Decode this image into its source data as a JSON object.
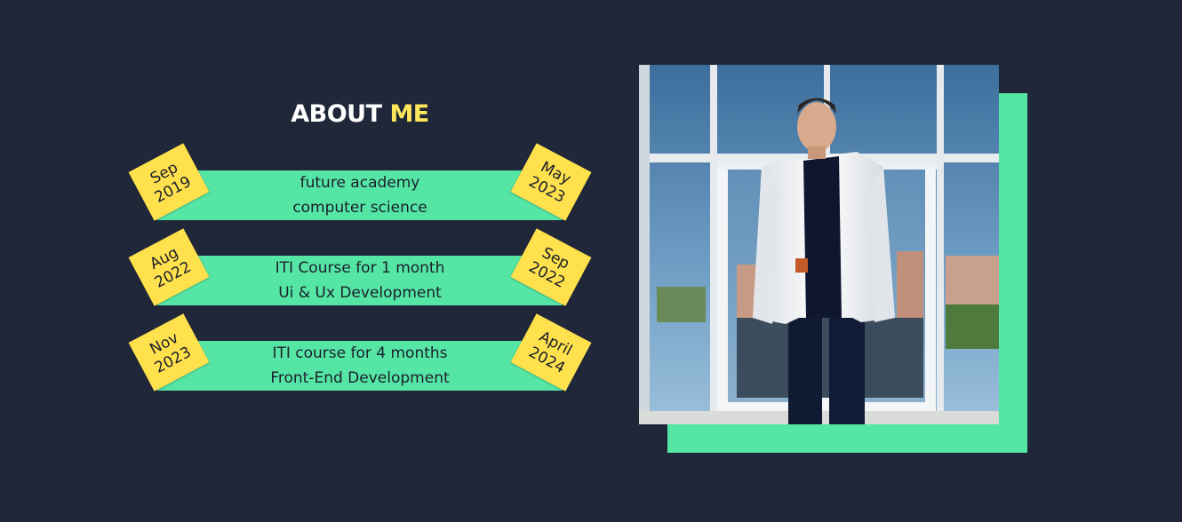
{
  "about": {
    "title_main": "ABOUT",
    "title_accent": "ME"
  },
  "timeline": [
    {
      "start_month": "Sep",
      "start_year": "2019",
      "line1": "future academy",
      "line2": "computer science",
      "end_month": "May",
      "end_year": "2023"
    },
    {
      "start_month": "Aug",
      "start_year": "2022",
      "line1": "ITI Course for 1 month",
      "line2": "Ui & Ux Development",
      "end_month": "Sep",
      "end_year": "2022"
    },
    {
      "start_month": "Nov",
      "start_year": "2023",
      "line1": "ITI course for 4 months",
      "line2": "Front-End Development",
      "end_month": "April",
      "end_year": "2024"
    }
  ],
  "colors": {
    "background": "#1f2739",
    "accent_green": "#55e6a5",
    "accent_yellow": "#ffe14d",
    "title_accent": "#ffe65a"
  },
  "photo": {
    "icon": "profile-photo"
  }
}
